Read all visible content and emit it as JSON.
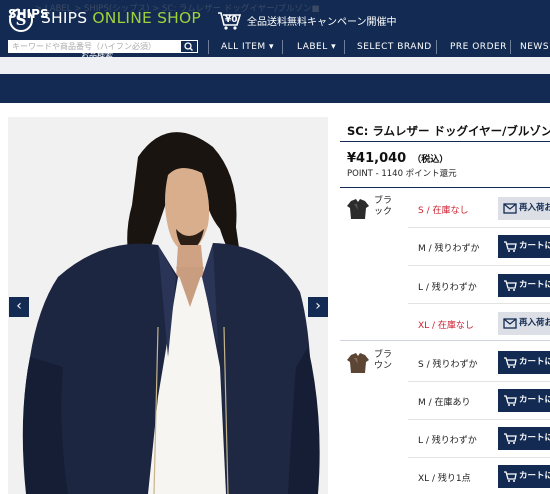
{
  "header": {
    "logo_letter": "S",
    "logo_text_main": "SHIPS",
    "logo_text_accent": "ONLINE SHOP",
    "promo_badge": "¥0",
    "promo_text": "全品送料無料キャンペーン開催中",
    "search_placeholder": "キーワードや商品番号（ハイフン必須）",
    "search_sub_label": "お品検索",
    "nav": [
      "ALL ITEM ▾",
      "LABEL ▾",
      "SELECT BRAND",
      "PRE ORDER",
      "NEWS"
    ]
  },
  "breadcrumb": {
    "text": "> LABEL > SHIPS(シップス) > SC: ラムレザー ドッグイヤー/ブルゾン■"
  },
  "section": {
    "title": "SHIPS"
  },
  "product": {
    "title": "SC: ラムレザー ドッグイヤー/ブルゾン■",
    "price": "¥41,040",
    "tax_label": "（税込）",
    "point": "POINT - 1140 ポイント還元",
    "colors": [
      {
        "name": "ブラック",
        "swatch_color": "#2c2c2c",
        "sizes": [
          {
            "label": "S / 在庫なし",
            "status": "none",
            "button": "再入荷お"
          },
          {
            "label": "M / 残りわずか",
            "status": "few",
            "button": "カートに入"
          },
          {
            "label": "L / 残りわずか",
            "status": "few",
            "button": "カートに入"
          },
          {
            "label": "XL / 在庫なし",
            "status": "none",
            "button": "再入荷お"
          }
        ]
      },
      {
        "name": "ブラウン",
        "swatch_color": "#5b4535",
        "sizes": [
          {
            "label": "S / 残りわずか",
            "status": "few",
            "button": "カートに入"
          },
          {
            "label": "M / 在庫あり",
            "status": "ok",
            "button": "カートに入"
          },
          {
            "label": "L / 残りわずか",
            "status": "few",
            "button": "カートに入"
          },
          {
            "label": "XL / 残り1点",
            "status": "few",
            "button": "カートに入"
          }
        ]
      }
    ]
  },
  "carousel": {
    "prev": "‹",
    "next": "›"
  },
  "colors": {
    "navy": "#132b52",
    "accent_green": "#9fd23a",
    "alert_red": "#cc1f2e"
  }
}
